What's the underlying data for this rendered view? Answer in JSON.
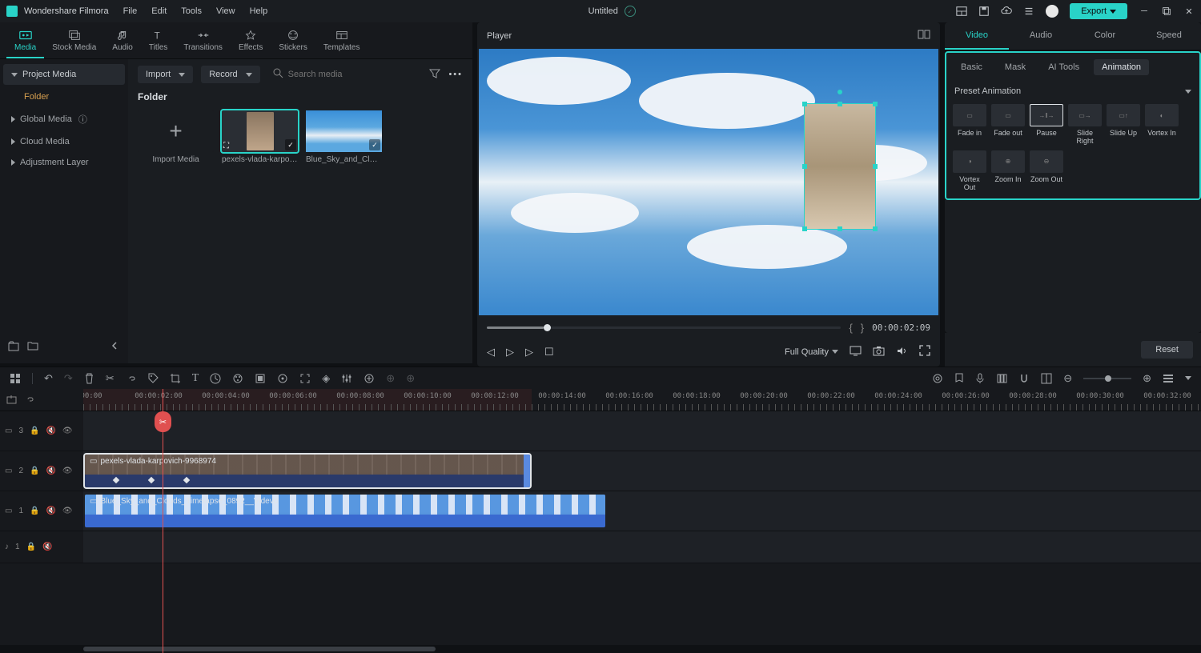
{
  "app_name": "Wondershare Filmora",
  "menubar": [
    "File",
    "Edit",
    "Tools",
    "View",
    "Help"
  ],
  "doc_title": "Untitled",
  "export_label": "Export",
  "nav_tabs": [
    "Media",
    "Stock Media",
    "Audio",
    "Titles",
    "Transitions",
    "Effects",
    "Stickers",
    "Templates"
  ],
  "sidebar": {
    "project": "Project Media",
    "folder": "Folder",
    "global": "Global Media",
    "cloud": "Cloud Media",
    "adjustment": "Adjustment Layer"
  },
  "browser": {
    "dd_import": "Import",
    "dd_record": "Record",
    "search_placeholder": "Search media",
    "section_title": "Folder",
    "import_label": "Import Media",
    "clip1": "pexels-vlada-karpovic...",
    "clip2": "Blue_Sky_and_Clouds..."
  },
  "player": {
    "title": "Player",
    "quality": "Full Quality",
    "timecode": "00:00:02:09"
  },
  "right_tabs": [
    "Video",
    "Audio",
    "Color",
    "Speed"
  ],
  "sub_tabs": [
    "Basic",
    "Mask",
    "AI Tools",
    "Animation"
  ],
  "preset_label": "Preset Animation",
  "anim_presets": [
    "Fade in",
    "Fade out",
    "Pause",
    "Slide Right",
    "Slide Up",
    "Vortex In",
    "Vortex Out",
    "Zoom In",
    "Zoom Out"
  ],
  "reset_label": "Reset",
  "ruler_labels": [
    "00:00",
    "00:00:02:00",
    "00:00:04:00",
    "00:00:06:00",
    "00:00:08:00",
    "00:00:10:00",
    "00:00:12:00",
    "00:00:14:00",
    "00:00:16:00",
    "00:00:18:00",
    "00:00:20:00",
    "00:00:22:00",
    "00:00:24:00",
    "00:00:26:00",
    "00:00:28:00",
    "00:00:30:00",
    "00:00:32:00"
  ],
  "track_labels": {
    "v3": "3",
    "v2": "2",
    "v1": "1",
    "a1": "1"
  },
  "clip_names": {
    "c1": "pexels-vlada-karpovich-9968974",
    "c2": "Blue_Sky_and_Clouds_Timelapse_0892__Videvo"
  }
}
